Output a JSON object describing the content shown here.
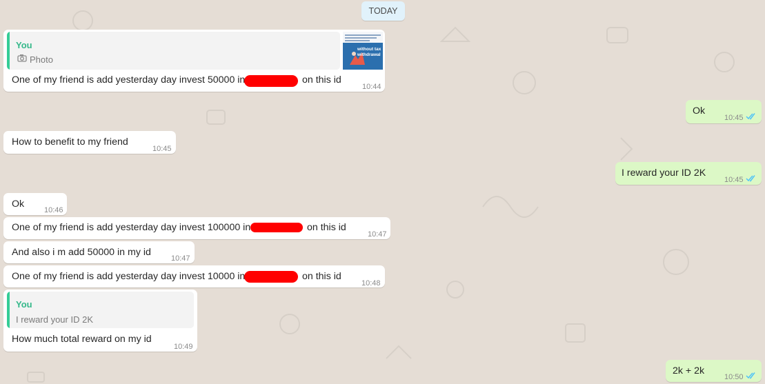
{
  "date_separator": "TODAY",
  "messages": [
    {
      "text_before": "One of my friend is add yesterday day invest 50000 in",
      "text_after": "on this id",
      "time": "10:44",
      "quote": {
        "author": "You",
        "type_label": "Photo",
        "thumbnail_text": "without tax withdrawal"
      }
    },
    {
      "text": "Ok",
      "time": "10:45"
    },
    {
      "text": "How to benefit to my friend",
      "time": "10:45"
    },
    {
      "text": "I reward your ID 2K",
      "time": "10:45"
    },
    {
      "text": "Ok",
      "time": "10:46"
    },
    {
      "text_before": "One of my friend is add yesterday day invest 100000 in",
      "text_after": "on this id",
      "time": "10:47"
    },
    {
      "text": "And also i m add 50000 in my id",
      "time": "10:47"
    },
    {
      "text_before": "One of my friend is add yesterday day invest 10000 in",
      "text_after": "on this id",
      "time": "10:48"
    },
    {
      "text": "How much total reward on my id",
      "time": "10:49",
      "quote": {
        "author": "You",
        "text": "I reward your ID 2K"
      }
    },
    {
      "text": "2k + 2k",
      "time": "10:50"
    }
  ],
  "colors": {
    "background": "#e5ddd5",
    "incoming_bubble": "#ffffff",
    "outgoing_bubble": "#dcf8c6",
    "quote_accent": "#35cd96",
    "read_ticks": "#4fc3f7",
    "redaction": "#ff0000"
  },
  "icons": [
    "camera-icon",
    "double-check-icon"
  ]
}
